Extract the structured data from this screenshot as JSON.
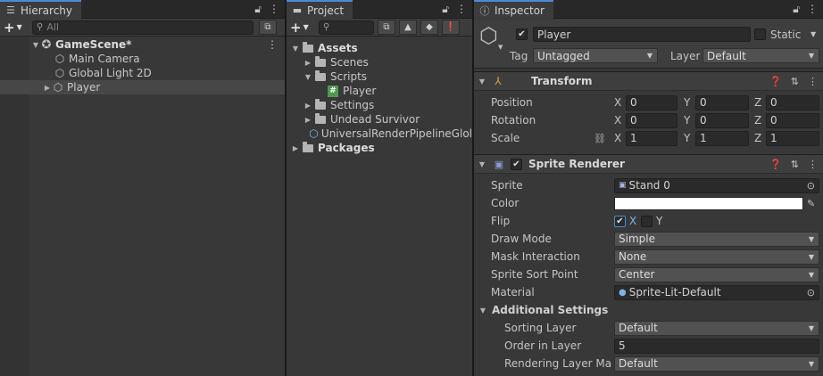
{
  "hierarchy": {
    "tab": "Hierarchy",
    "search_placeholder": "All",
    "scene": "GameScene*",
    "items": [
      "Main Camera",
      "Global Light 2D",
      "Player"
    ]
  },
  "project": {
    "tab": "Project",
    "root": "Assets",
    "folders": [
      "Scenes",
      "Scripts",
      "Settings",
      "Undead Survivor"
    ],
    "script": "Player",
    "asset": "UniversalRenderPipelineGlol",
    "packages": "Packages"
  },
  "inspector": {
    "tab": "Inspector",
    "object_name": "Player",
    "static_label": "Static",
    "tag_label": "Tag",
    "tag_value": "Untagged",
    "layer_label": "Layer",
    "layer_value": "Default",
    "transform": {
      "title": "Transform",
      "rows": [
        {
          "label": "Position",
          "x": "0",
          "y": "0",
          "z": "0"
        },
        {
          "label": "Rotation",
          "x": "0",
          "y": "0",
          "z": "0"
        },
        {
          "label": "Scale",
          "x": "1",
          "y": "1",
          "z": "1"
        }
      ]
    },
    "axes": {
      "x": "X",
      "y": "Y",
      "z": "Z"
    },
    "sprite_renderer": {
      "title": "Sprite Renderer",
      "sprite_label": "Sprite",
      "sprite_value": "Stand 0",
      "color_label": "Color",
      "flip_label": "Flip",
      "flip_x": "X",
      "flip_y": "Y",
      "draw_mode_label": "Draw Mode",
      "draw_mode_value": "Simple",
      "mask_label": "Mask Interaction",
      "mask_value": "None",
      "sort_point_label": "Sprite Sort Point",
      "sort_point_value": "Center",
      "material_label": "Material",
      "material_value": "Sprite-Lit-Default",
      "additional_title": "Additional Settings",
      "sorting_layer_label": "Sorting Layer",
      "sorting_layer_value": "Default",
      "order_label": "Order in Layer",
      "order_value": "5",
      "render_layer_label": "Rendering Layer Mas",
      "render_layer_value": "Default"
    }
  },
  "colors": {
    "accent": "#4b8ad8",
    "panel": "#383838",
    "field": "#2a2a2a"
  }
}
